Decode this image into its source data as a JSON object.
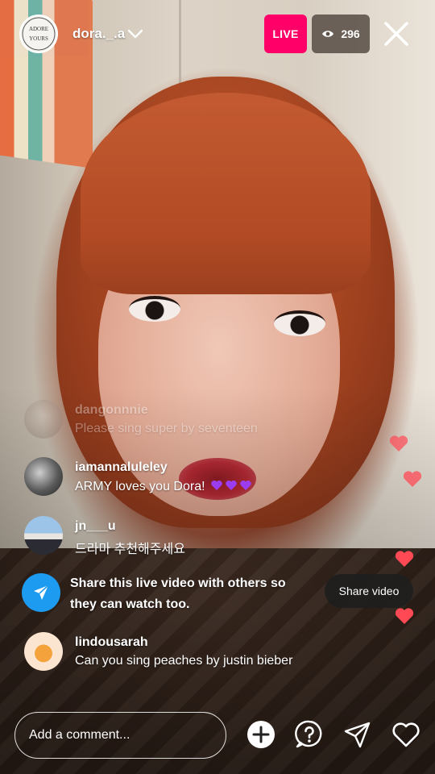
{
  "header": {
    "username": "dora._.a",
    "live_label": "LIVE",
    "viewer_count": "296",
    "avatar_text": "ADORE YOURS"
  },
  "comments": [
    {
      "username": "dangonnnie",
      "text": "Please sing super by seventeen",
      "faded": true
    },
    {
      "username": "iamannaluleley",
      "text": "ARMY loves you Dora!",
      "emoji": [
        "purple-heart",
        "purple-heart",
        "purple-heart"
      ]
    },
    {
      "username": "jn___u",
      "text": "드라마 추천해주세요"
    }
  ],
  "share_prompt": {
    "text": "Share this live video with others so they can watch too.",
    "button_label": "Share video"
  },
  "last_comment": {
    "username": "lindousarah",
    "text": "Can you sing peaches by justin bieber"
  },
  "bottom_bar": {
    "comment_placeholder": "Add a comment...",
    "icons": [
      "add-icon",
      "question-icon",
      "send-icon",
      "heart-icon"
    ]
  },
  "colors": {
    "live_badge": "#ff0069",
    "share_blue": "#1d9bf0",
    "floating_heart": "#ff4a55"
  }
}
